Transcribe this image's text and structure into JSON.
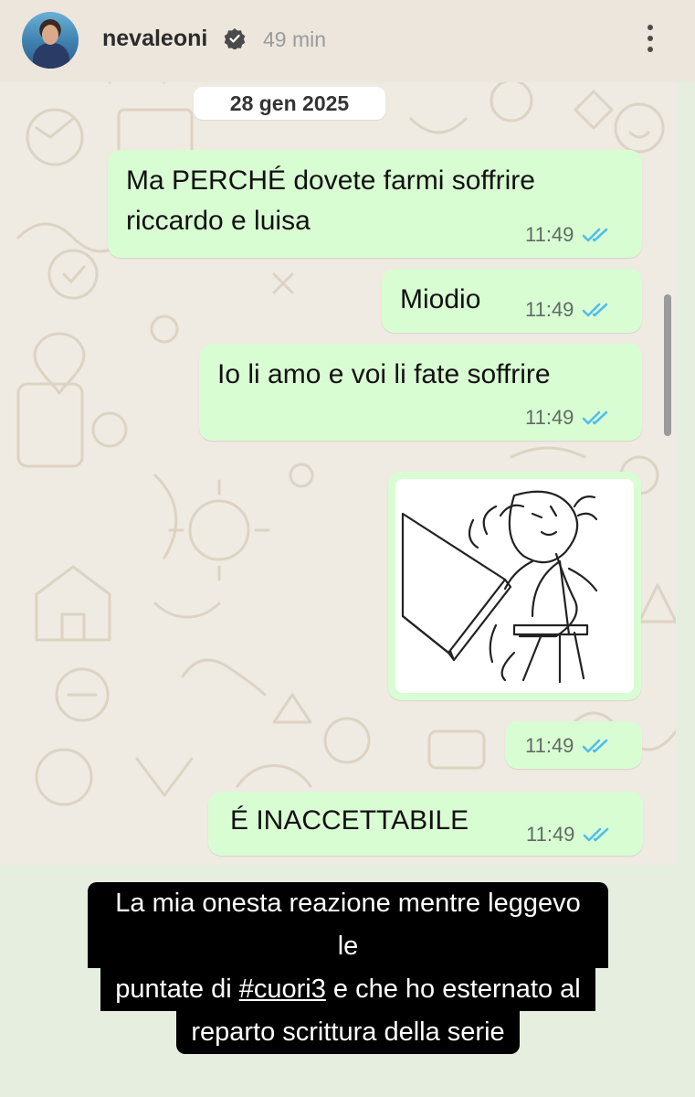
{
  "header": {
    "username": "nevaleoni",
    "time_ago": "49 min"
  },
  "chat": {
    "date": "28 gen 2025",
    "messages": [
      {
        "text_line1": "Ma PERCHÉ dovete farmi soffrire",
        "text_line2": "riccardo e luisa",
        "time": "11:49"
      },
      {
        "text": "Miodio",
        "time": "11:49"
      },
      {
        "text": "Io li amo e voi li fate soffrire",
        "time": "11:49"
      },
      {
        "type": "image",
        "image_desc": "table flip meme",
        "time": "11:49"
      },
      {
        "text": "É INACCETTABILE",
        "time": "11:49"
      }
    ]
  },
  "caption": {
    "line1": "La mia onesta reazione mentre leggevo le",
    "line2_before": "puntate di ",
    "hashtag": "#cuori3",
    "line2_after": " e che ho esternato al",
    "line3": "reparto scrittura della serie"
  },
  "colors": {
    "outgoing_bubble": "#d9fdd3",
    "chat_background": "#efeae2",
    "read_ticks": "#53bdeb",
    "caption_background": "#000000"
  }
}
